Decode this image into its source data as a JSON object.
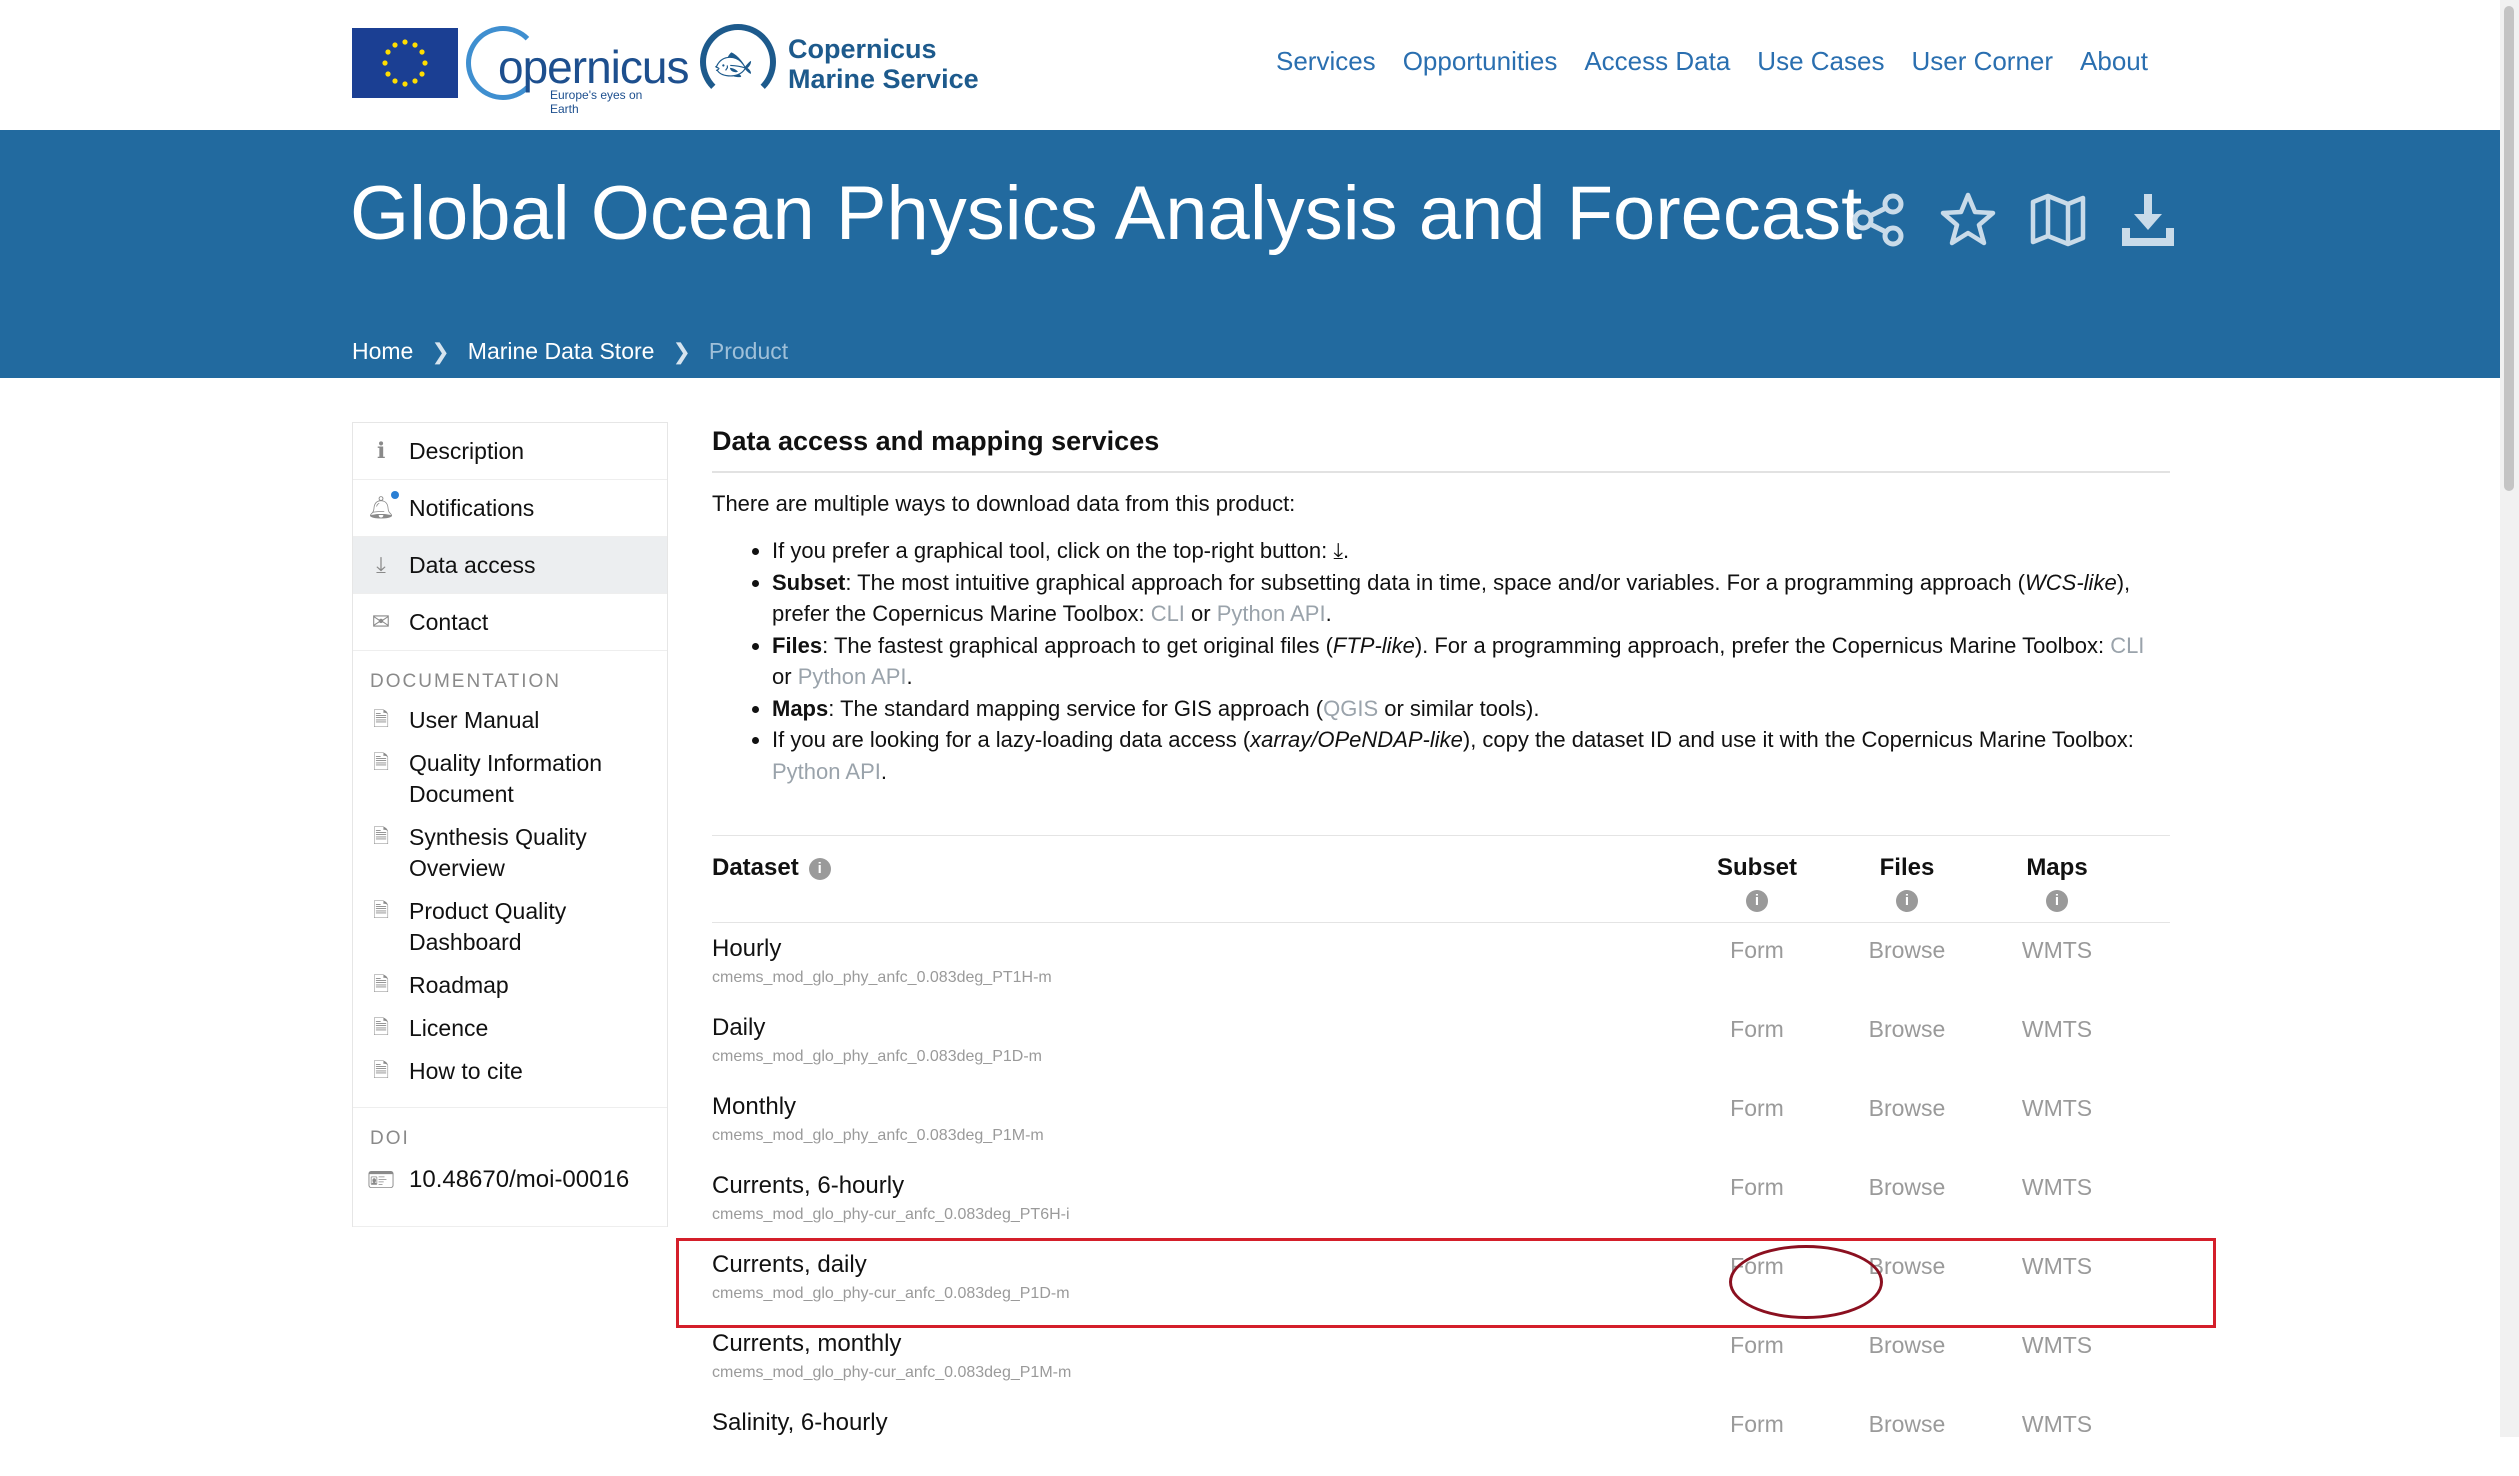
{
  "header": {
    "copernicus_word": "opernicus",
    "copernicus_tagline": "Europe's eyes on Earth",
    "cms_line1": "Copernicus",
    "cms_line2": "Marine Service",
    "nav": [
      "Services",
      "Opportunities",
      "Access Data",
      "Use Cases",
      "User Corner",
      "About"
    ]
  },
  "banner": {
    "title": "Global Ocean Physics Analysis and Forecast",
    "breadcrumb": [
      "Home",
      "Marine Data Store",
      "Product"
    ]
  },
  "sidebar": {
    "items": [
      {
        "label": "Description",
        "icon": "info-icon"
      },
      {
        "label": "Notifications",
        "icon": "bell-icon"
      },
      {
        "label": "Data access",
        "icon": "download-icon"
      },
      {
        "label": "Contact",
        "icon": "mail-icon"
      }
    ],
    "doc_heading": "DOCUMENTATION",
    "docs": [
      "User Manual",
      "Quality Information Document",
      "Synthesis Quality Overview",
      "Product Quality Dashboard",
      "Roadmap",
      "Licence",
      "How to cite"
    ],
    "doi_heading": "DOI",
    "doi": "10.48670/moi-00016"
  },
  "main": {
    "heading": "Data access and mapping services",
    "intro": "There are multiple ways to download data from this product:",
    "b1": "If you prefer a graphical tool, click on the top-right button: ",
    "b2_bold": "Subset",
    "b2_a": ": The most intuitive graphical approach for subsetting data in time, space and/or variables. For a programming approach (",
    "b2_i": "WCS-like",
    "b2_b": "), prefer the Copernicus Marine Toolbox: ",
    "cli": "CLI",
    "or": " or ",
    "python_api": "Python API",
    "dot": ".",
    "b3_bold": "Files",
    "b3_a": ": The fastest graphical approach to get original files (",
    "b3_i": "FTP-like",
    "b3_b": "). For a programming approach, prefer the Copernicus Marine Toolbox: ",
    "b4_bold": "Maps",
    "b4_a": ": The standard mapping service for GIS approach (",
    "qgis": "QGIS",
    "b4_b": " or similar tools).",
    "b5_a": "If you are looking for a lazy-loading data access (",
    "b5_i": "xarray/OPeNDAP-like",
    "b5_b": "), copy the dataset ID and use it with the Copernicus Marine Toolbox: "
  },
  "table": {
    "dataset_header": "Dataset",
    "subset_header": "Subset",
    "files_header": "Files",
    "maps_header": "Maps",
    "rows": [
      {
        "name": "Hourly",
        "id": "cmems_mod_glo_phy_anfc_0.083deg_PT1H-m",
        "subset": "Form",
        "files": "Browse",
        "maps": "WMTS"
      },
      {
        "name": "Daily",
        "id": "cmems_mod_glo_phy_anfc_0.083deg_P1D-m",
        "subset": "Form",
        "files": "Browse",
        "maps": "WMTS"
      },
      {
        "name": "Monthly",
        "id": "cmems_mod_glo_phy_anfc_0.083deg_P1M-m",
        "subset": "Form",
        "files": "Browse",
        "maps": "WMTS"
      },
      {
        "name": "Currents, 6-hourly",
        "id": "cmems_mod_glo_phy-cur_anfc_0.083deg_PT6H-i",
        "subset": "Form",
        "files": "Browse",
        "maps": "WMTS"
      },
      {
        "name": "Currents, daily",
        "id": "cmems_mod_glo_phy-cur_anfc_0.083deg_P1D-m",
        "subset": "Form",
        "files": "Browse",
        "maps": "WMTS"
      },
      {
        "name": "Currents, monthly",
        "id": "cmems_mod_glo_phy-cur_anfc_0.083deg_P1M-m",
        "subset": "Form",
        "files": "Browse",
        "maps": "WMTS"
      },
      {
        "name": "Salinity, 6-hourly",
        "id": "",
        "subset": "Form",
        "files": "Browse",
        "maps": "WMTS"
      }
    ]
  },
  "colors": {
    "banner": "#226a9f",
    "nav_link": "#2a6fb0",
    "highlight_box": "#d41f2a",
    "highlight_ellipse": "#8b1020"
  }
}
